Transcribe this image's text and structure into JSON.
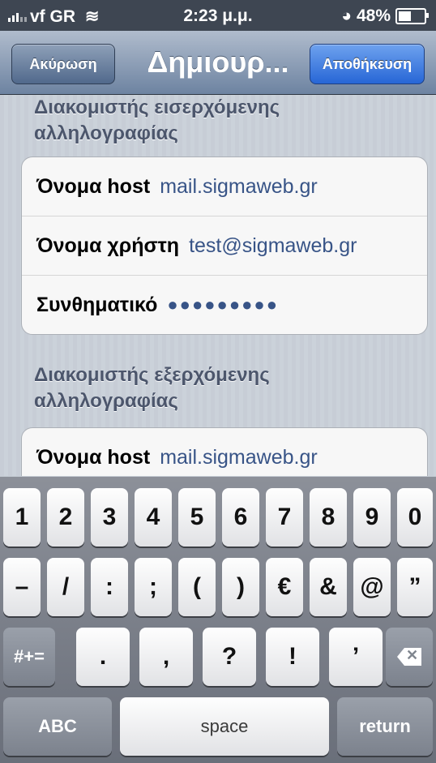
{
  "status": {
    "carrier": "vf GR",
    "time": "2:23 μ.μ.",
    "battery": "48%"
  },
  "nav": {
    "cancel": "Ακύρωση",
    "title": "Δημιουρ...",
    "save": "Αποθήκευση"
  },
  "incoming": {
    "title_line1": "Διακομιστής εισερχόμενης",
    "title_line2": "αλληλογραφίας",
    "rows": [
      {
        "label": "Όνομα host",
        "value": "mail.sigmaweb.gr"
      },
      {
        "label": "Όνομα χρήστη",
        "value": "test@sigmaweb.gr"
      },
      {
        "label": "Συνθηματικό",
        "value": "●●●●●●●●●"
      }
    ]
  },
  "outgoing": {
    "title_line1": "Διακομιστής εξερχόμενης",
    "title_line2": "αλληλογραφίας",
    "rows": [
      {
        "label": "Όνομα host",
        "value": "mail.sigmaweb.gr"
      }
    ]
  },
  "keyboard": {
    "row1": [
      "1",
      "2",
      "3",
      "4",
      "5",
      "6",
      "7",
      "8",
      "9",
      "0"
    ],
    "row2": [
      "–",
      "/",
      ":",
      ";",
      "(",
      ")",
      "€",
      "&",
      "@",
      "”"
    ],
    "row3": [
      ".",
      ",",
      "?",
      "!",
      "’"
    ],
    "symbols": "#+=",
    "abc": "ABC",
    "space": "space",
    "return": "return"
  }
}
